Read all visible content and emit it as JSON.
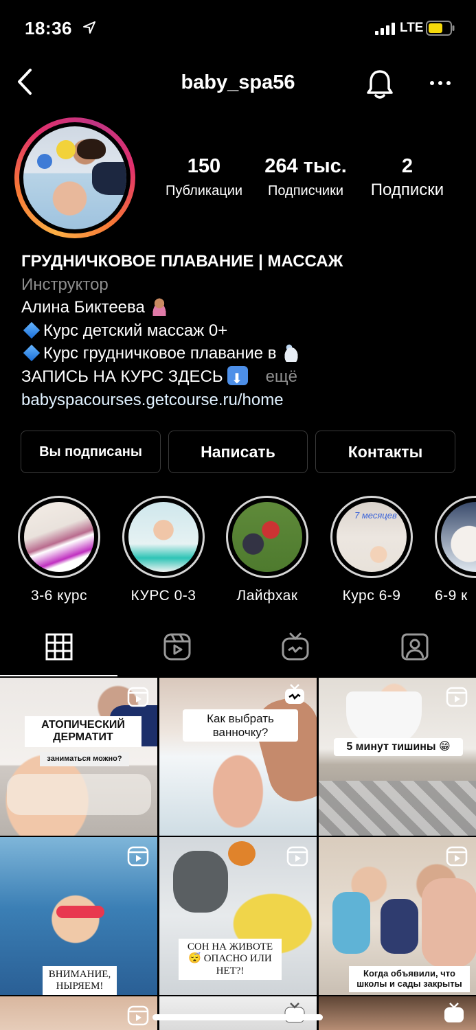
{
  "status_bar": {
    "time": "18:36",
    "network": "LTE"
  },
  "header": {
    "username": "baby_spa56"
  },
  "stats": [
    {
      "value": "150",
      "label": "Публикации"
    },
    {
      "value": "264 тыс.",
      "label": "Подписчики"
    },
    {
      "value": "2",
      "label": "Подписки"
    }
  ],
  "bio": {
    "name": "ГРУДНИЧКОВОЕ ПЛАВАНИЕ | МАССАЖ",
    "category": "Инструктор",
    "line1": "Алина Биктеева",
    "line2": "Курс детский массаж 0+",
    "line3": "Курс грудничковое плавание в",
    "line4": "ЗАПИСЬ НА КУРС ЗДЕСЬ",
    "more": "ещё",
    "link": "babyspacourses.getcourse.ru/home"
  },
  "buttons": {
    "following": "Вы подписаны",
    "message": "Написать",
    "contacts": "Контакты"
  },
  "highlights": [
    {
      "label": "3-6 курс"
    },
    {
      "label": "КУРС 0-3"
    },
    {
      "label": "Лайфхак"
    },
    {
      "label": "Курс 6-9",
      "overlay_text": "7 месяцев"
    },
    {
      "label": "6-9 к"
    }
  ],
  "tabs": {
    "active": "grid",
    "icons": [
      "grid-icon",
      "reels-icon",
      "igtv-icon",
      "tagged-icon"
    ]
  },
  "posts": [
    {
      "caption": "АТОПИЧЕСКИЙ ДЕРМАТИТ",
      "subcaption": "заниматься можно?",
      "type": "reel"
    },
    {
      "caption": "Как выбрать ванночку?",
      "type": "igtv"
    },
    {
      "caption": "5 минут тишины 😁",
      "type": "reel"
    },
    {
      "caption": "ВНИМАНИЕ, НЫРЯЕМ!",
      "type": "reel"
    },
    {
      "caption": "СОН НА ЖИВОТЕ 😴 ОПАСНО ИЛИ НЕТ?!",
      "type": "reel"
    },
    {
      "caption": "Когда объявили, что школы и сады закрыты",
      "type": "reel"
    },
    {
      "type": "reel"
    },
    {
      "type": "igtv"
    },
    {
      "type": "igtv"
    }
  ],
  "colors": {
    "background": "#000000",
    "link": "#e0f1ff",
    "muted": "#8e8e8e",
    "battery": "#f5d90a"
  }
}
